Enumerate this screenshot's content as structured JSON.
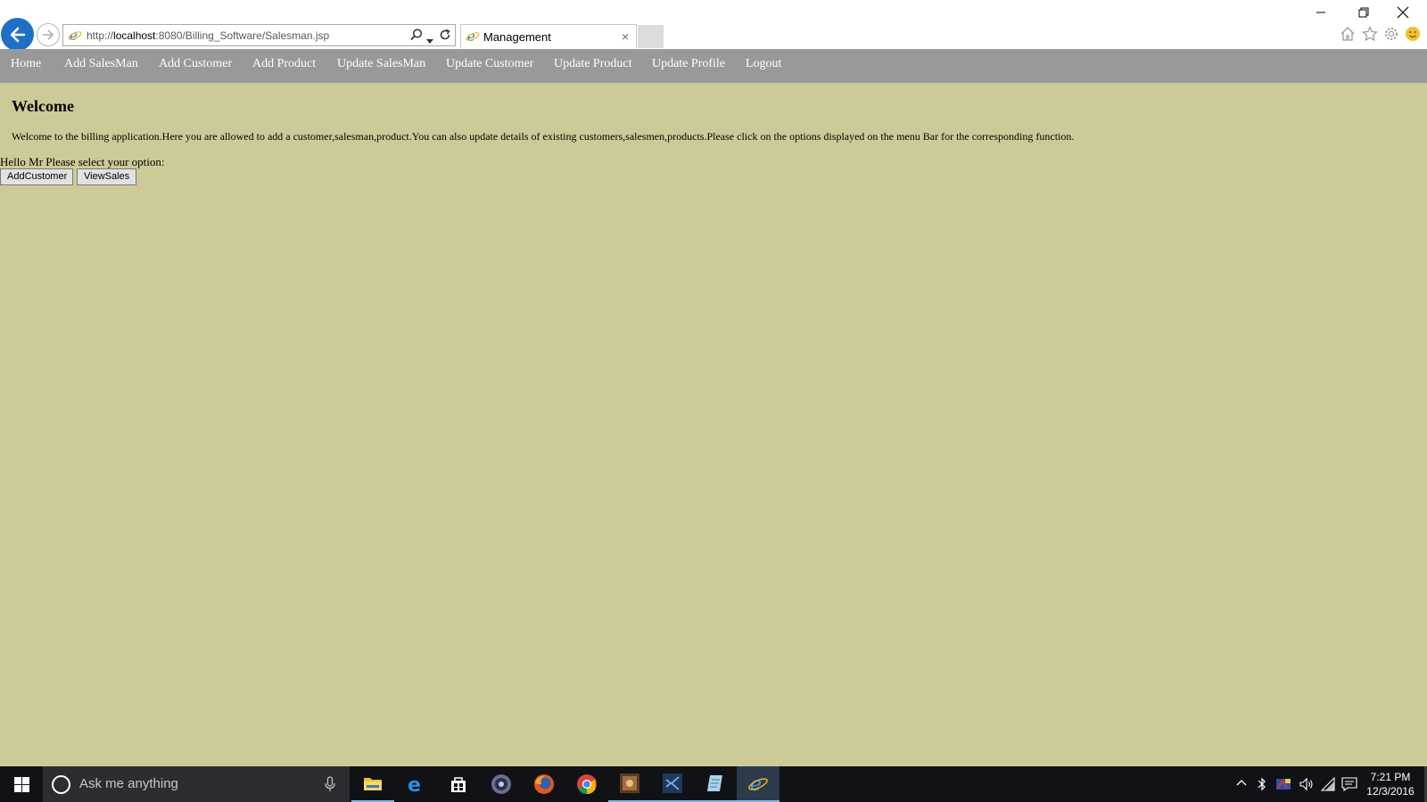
{
  "browser": {
    "url_prefix": "http://",
    "url_host": "localhost",
    "url_rest": ":8080/Billing_Software/Salesman.jsp",
    "tab_title": "Management",
    "tab_close": "×"
  },
  "menu": {
    "items": [
      {
        "label": "Home"
      },
      {
        "label": "Add SalesMan"
      },
      {
        "label": "Add Customer"
      },
      {
        "label": "Add Product"
      },
      {
        "label": "Update SalesMan"
      },
      {
        "label": "Update Customer"
      },
      {
        "label": "Update Product"
      },
      {
        "label": "Update Profile"
      },
      {
        "label": "Logout"
      }
    ]
  },
  "content": {
    "heading": "Welcome",
    "intro": "Welcome to the billing application.Here you are allowed to add a customer,salesman,product.You can also update details of existing customers,salesmen,products.Please click on the options displayed on the menu Bar for the corresponding function.",
    "greeting": "Hello Mr Please select your option:",
    "buttons": {
      "add_customer": "AddCustomer",
      "view_sales": "ViewSales"
    }
  },
  "taskbar": {
    "search_placeholder": "Ask me anything",
    "apps": [
      "file-explorer",
      "edge",
      "store",
      "media-player",
      "firefox",
      "chrome",
      "game-app",
      "visual-studio",
      "notepad-app",
      "internet-explorer"
    ],
    "clock_time": "7:21 PM",
    "clock_date": "12/3/2016"
  },
  "colors": {
    "page_background": "#cccb97",
    "menubar_background": "#999999",
    "menu_text": "#ffffff",
    "ie_accent": "#1e6fc8",
    "taskbar": "#101216"
  }
}
